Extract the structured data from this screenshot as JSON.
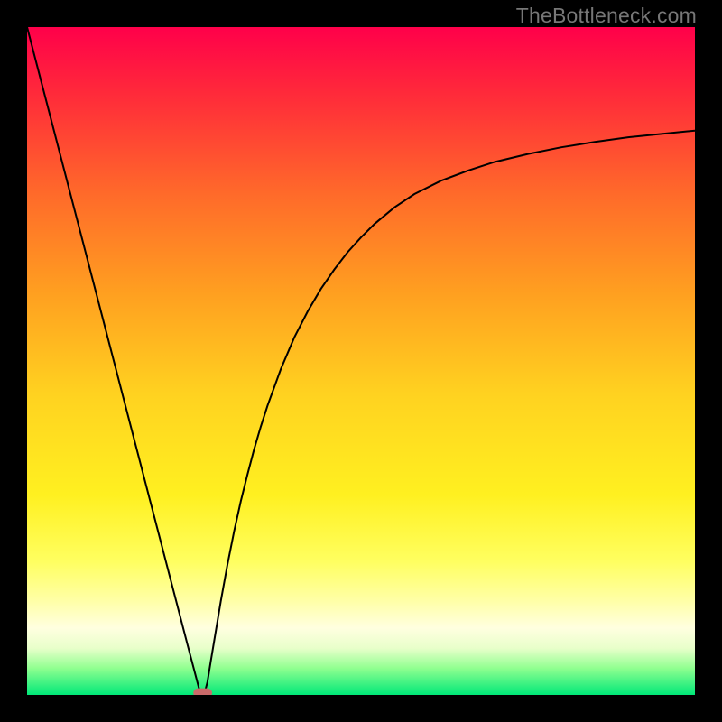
{
  "watermark": "TheBottleneck.com",
  "chart_data": {
    "type": "line",
    "title": "",
    "xlabel": "",
    "ylabel": "",
    "xlim": [
      0,
      100
    ],
    "ylim": [
      0,
      100
    ],
    "x_axis_visible": false,
    "y_axis_visible": false,
    "grid": false,
    "legend": false,
    "background": {
      "kind": "vertical-gradient",
      "stops": [
        {
          "offset": 0.0,
          "color": "#ff004a"
        },
        {
          "offset": 0.1,
          "color": "#ff2a3a"
        },
        {
          "offset": 0.25,
          "color": "#ff6a2a"
        },
        {
          "offset": 0.4,
          "color": "#ffa020"
        },
        {
          "offset": 0.55,
          "color": "#ffd220"
        },
        {
          "offset": 0.7,
          "color": "#fff020"
        },
        {
          "offset": 0.8,
          "color": "#ffff60"
        },
        {
          "offset": 0.86,
          "color": "#ffffa8"
        },
        {
          "offset": 0.9,
          "color": "#ffffe0"
        },
        {
          "offset": 0.93,
          "color": "#e8ffca"
        },
        {
          "offset": 0.96,
          "color": "#90ff90"
        },
        {
          "offset": 1.0,
          "color": "#00e878"
        }
      ]
    },
    "series": [
      {
        "name": "curve",
        "type": "line",
        "color": "#000000",
        "width": 2,
        "x": [
          0.0,
          2.0,
          4.0,
          6.0,
          8.0,
          10.0,
          12.0,
          14.0,
          16.0,
          18.0,
          20.0,
          22.0,
          24.0,
          25.0,
          25.5,
          26.0,
          26.5,
          27.0,
          27.5,
          28.0,
          29.0,
          30.0,
          31.0,
          32.0,
          33.0,
          34.0,
          35.0,
          36.0,
          38.0,
          40.0,
          42.0,
          44.0,
          46.0,
          48.0,
          50.0,
          52.0,
          55.0,
          58.0,
          62.0,
          66.0,
          70.0,
          75.0,
          80.0,
          85.0,
          90.0,
          95.0,
          100.0
        ],
        "y": [
          100.0,
          92.3,
          84.6,
          76.9,
          69.2,
          61.5,
          53.8,
          46.1,
          38.4,
          30.7,
          23.0,
          15.3,
          7.6,
          3.8,
          1.9,
          0.0,
          0.0,
          1.9,
          5.0,
          8.0,
          14.0,
          19.5,
          24.5,
          29.0,
          33.0,
          36.8,
          40.2,
          43.3,
          48.8,
          53.5,
          57.4,
          60.8,
          63.7,
          66.3,
          68.5,
          70.5,
          73.0,
          75.0,
          77.0,
          78.5,
          79.8,
          81.0,
          82.0,
          82.8,
          83.5,
          84.0,
          84.5
        ]
      }
    ],
    "markers": [
      {
        "name": "min-marker",
        "x": 26.3,
        "y": 0.3,
        "shape": "rounded-rect",
        "width_pct": 2.8,
        "height_pct": 1.4,
        "color": "#c96a6a"
      }
    ]
  }
}
